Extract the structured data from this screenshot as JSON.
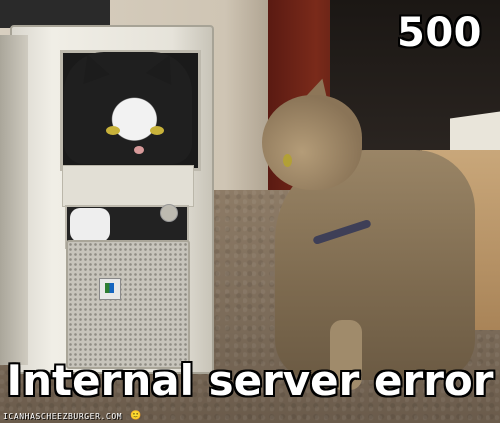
{
  "caption": {
    "top": "500",
    "bottom": "Internal server error"
  },
  "watermark": {
    "text": "ICANHASCHEEZBURGER.COM"
  },
  "colors": {
    "caption_fill": "#ffffff",
    "caption_outline": "#000000"
  }
}
